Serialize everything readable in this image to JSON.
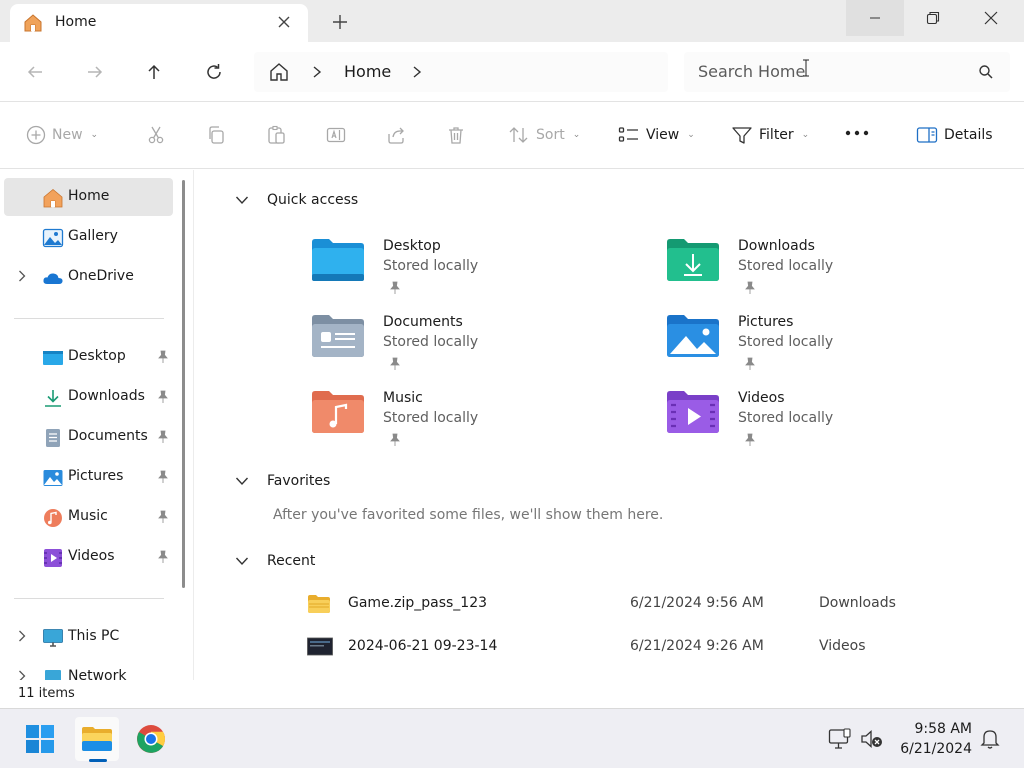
{
  "window": {
    "tab_title": "Home",
    "new_tab_label": "+"
  },
  "address": {
    "crumb": "Home",
    "search_placeholder": "Search Home"
  },
  "commands": {
    "new": "New",
    "sort": "Sort",
    "view": "View",
    "filter": "Filter",
    "details": "Details"
  },
  "sidebar": {
    "home": "Home",
    "gallery": "Gallery",
    "onedrive": "OneDrive",
    "desktop": "Desktop",
    "downloads": "Downloads",
    "documents": "Documents",
    "pictures": "Pictures",
    "music": "Music",
    "videos": "Videos",
    "this_pc": "This PC",
    "network": "Network"
  },
  "main": {
    "quick_access_title": "Quick access",
    "quick_access": [
      {
        "name": "Desktop",
        "sub": "Stored locally"
      },
      {
        "name": "Downloads",
        "sub": "Stored locally"
      },
      {
        "name": "Documents",
        "sub": "Stored locally"
      },
      {
        "name": "Pictures",
        "sub": "Stored locally"
      },
      {
        "name": "Music",
        "sub": "Stored locally"
      },
      {
        "name": "Videos",
        "sub": "Stored locally"
      }
    ],
    "favorites_title": "Favorites",
    "favorites_empty": "After you've favorited some files, we'll show them here.",
    "recent_title": "Recent",
    "recent": [
      {
        "name": "Game.zip_pass_123",
        "date": "6/21/2024 9:56 AM",
        "location": "Downloads"
      },
      {
        "name": "2024-06-21 09-23-14",
        "date": "6/21/2024 9:26 AM",
        "location": "Videos"
      }
    ]
  },
  "status": {
    "item_count": "11 items"
  },
  "taskbar": {
    "time": "9:58 AM",
    "date": "6/21/2024"
  },
  "colors": {
    "accent": "#005fb8",
    "folder_blue": "#2aa3e8",
    "folder_green": "#1eb98a",
    "folder_yellow": "#f5c242"
  }
}
